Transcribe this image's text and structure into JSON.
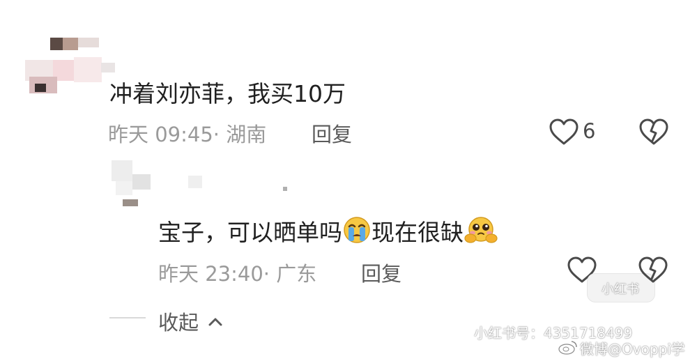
{
  "comments": [
    {
      "text_prefix": "冲着刘亦菲，我买10万",
      "time": "昨天 09:45",
      "location": "湖南",
      "reply_label": "回复",
      "likes": "6"
    },
    {
      "text_part1": "宝子，可以晒单吗",
      "text_part2": "现在很缺",
      "emoji1": "crying-face",
      "emoji2": "pleading-face-hug",
      "time": "昨天 23:40",
      "location": "广东",
      "reply_label": "回复"
    }
  ],
  "collapse": {
    "label": "收起",
    "chevron": "chevron-up-icon"
  },
  "watermark": {
    "line1": "小红书号：4351718499",
    "line2": "微博@Ovoppi学",
    "stamp": "小红书"
  },
  "colors": {
    "text": "#202020",
    "meta": "#9a9a9a",
    "reply": "#5a5a5a",
    "icon": "#4a4a4a"
  }
}
